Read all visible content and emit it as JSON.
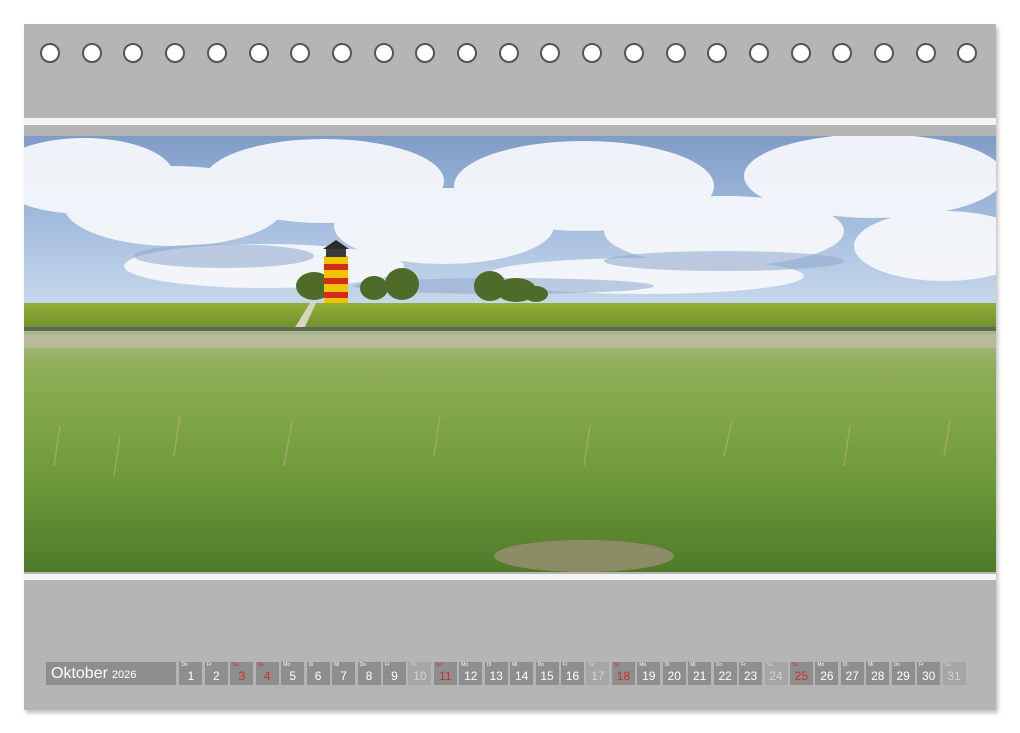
{
  "calendar": {
    "month": "Oktober",
    "year": "2026",
    "days": [
      {
        "wd": "Do",
        "num": "1",
        "type": "normal"
      },
      {
        "wd": "Fr",
        "num": "2",
        "type": "normal"
      },
      {
        "wd": "Sa",
        "num": "3",
        "type": "red"
      },
      {
        "wd": "So",
        "num": "4",
        "type": "red"
      },
      {
        "wd": "Mo",
        "num": "5",
        "type": "normal"
      },
      {
        "wd": "Di",
        "num": "6",
        "type": "normal"
      },
      {
        "wd": "Mi",
        "num": "7",
        "type": "normal"
      },
      {
        "wd": "Do",
        "num": "8",
        "type": "normal"
      },
      {
        "wd": "Fr",
        "num": "9",
        "type": "normal"
      },
      {
        "wd": "Sa",
        "num": "10",
        "type": "weekend"
      },
      {
        "wd": "So",
        "num": "11",
        "type": "red"
      },
      {
        "wd": "Mo",
        "num": "12",
        "type": "normal"
      },
      {
        "wd": "Di",
        "num": "13",
        "type": "normal"
      },
      {
        "wd": "Mi",
        "num": "14",
        "type": "normal"
      },
      {
        "wd": "Do",
        "num": "15",
        "type": "normal"
      },
      {
        "wd": "Fr",
        "num": "16",
        "type": "normal"
      },
      {
        "wd": "Sa",
        "num": "17",
        "type": "weekend"
      },
      {
        "wd": "So",
        "num": "18",
        "type": "red"
      },
      {
        "wd": "Mo",
        "num": "19",
        "type": "normal"
      },
      {
        "wd": "Di",
        "num": "20",
        "type": "normal"
      },
      {
        "wd": "Mi",
        "num": "21",
        "type": "normal"
      },
      {
        "wd": "Do",
        "num": "22",
        "type": "normal"
      },
      {
        "wd": "Fr",
        "num": "23",
        "type": "normal"
      },
      {
        "wd": "Sa",
        "num": "24",
        "type": "weekend"
      },
      {
        "wd": "So",
        "num": "25",
        "type": "red"
      },
      {
        "wd": "Mo",
        "num": "26",
        "type": "normal"
      },
      {
        "wd": "Di",
        "num": "27",
        "type": "normal"
      },
      {
        "wd": "Mi",
        "num": "28",
        "type": "normal"
      },
      {
        "wd": "Do",
        "num": "29",
        "type": "normal"
      },
      {
        "wd": "Fr",
        "num": "30",
        "type": "normal"
      },
      {
        "wd": "Sa",
        "num": "31",
        "type": "weekend"
      }
    ]
  },
  "colors": {
    "frame": "#b5b5b5",
    "cell": "#8e8e8e",
    "cell_weekend": "#a6a6a6",
    "holiday_red": "#d62b2b",
    "lighthouse_yellow": "#f2c400",
    "lighthouse_red": "#d42a1c"
  },
  "binding_holes": 23
}
